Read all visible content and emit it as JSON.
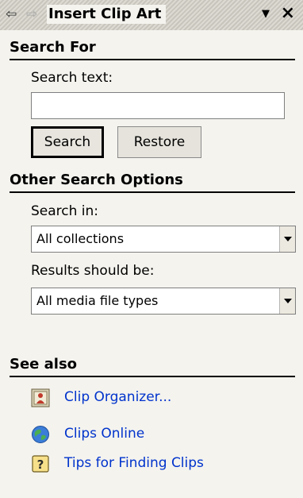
{
  "pane": {
    "title": "Insert Clip Art",
    "back_glyph": "⇦",
    "forward_glyph": "⇨",
    "dropdown_glyph": "▼",
    "close_glyph": "×"
  },
  "search_for": {
    "heading": "Search For",
    "search_text_label": "Search text:",
    "search_text_value": "",
    "search_button": "Search",
    "restore_button": "Restore"
  },
  "other_options": {
    "heading": "Other Search Options",
    "search_in_label": "Search in:",
    "search_in_value": "All collections",
    "results_label": "Results should be:",
    "results_value": "All media file types"
  },
  "see_also": {
    "heading": "See also",
    "links": [
      {
        "label": "Clip Organizer...",
        "icon": "clip-organizer-icon"
      },
      {
        "label": "Clips Online",
        "icon": "globe-icon"
      },
      {
        "label": "Tips for Finding Clips",
        "icon": "help-icon"
      }
    ]
  },
  "colors": {
    "background": "#f4f3ee",
    "link": "#0033cc"
  }
}
